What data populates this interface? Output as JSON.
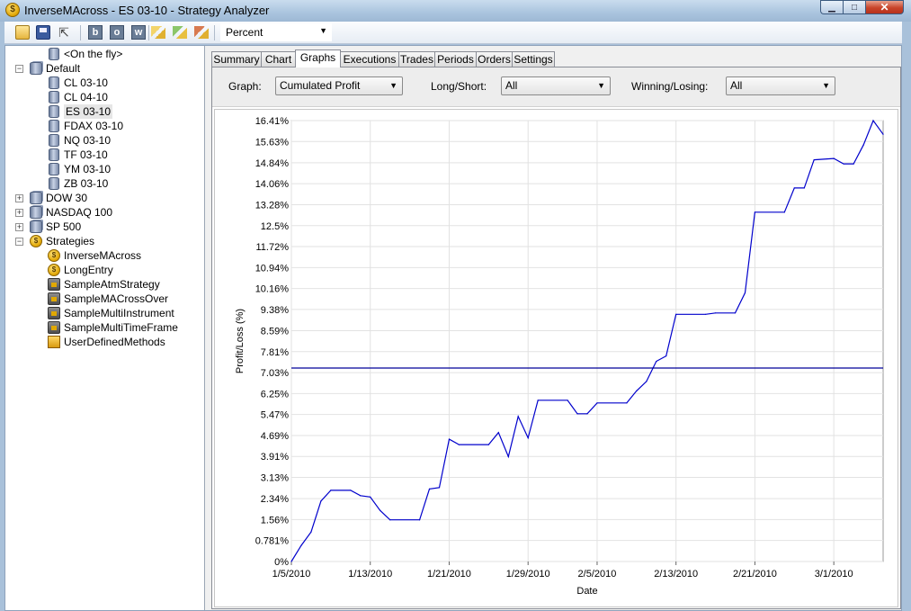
{
  "window": {
    "title": "InverseMAcross - ES 03-10 - Strategy Analyzer"
  },
  "toolbar": {
    "letter_buttons": [
      "b",
      "o",
      "w"
    ],
    "display_unit": "Percent"
  },
  "tree": [
    {
      "label": "<On the fly>",
      "icon": "database-icon",
      "level": 1,
      "expander": ""
    },
    {
      "label": "Default",
      "icon": "database-stack-icon",
      "level": 0,
      "expander": "−"
    },
    {
      "label": "CL 03-10",
      "icon": "database-icon",
      "level": 1,
      "expander": ""
    },
    {
      "label": "CL 04-10",
      "icon": "database-icon",
      "level": 1,
      "expander": ""
    },
    {
      "label": "ES 03-10",
      "icon": "database-icon",
      "level": 1,
      "expander": "",
      "selected": true
    },
    {
      "label": "FDAX 03-10",
      "icon": "database-icon",
      "level": 1,
      "expander": ""
    },
    {
      "label": "NQ 03-10",
      "icon": "database-icon",
      "level": 1,
      "expander": ""
    },
    {
      "label": "TF 03-10",
      "icon": "database-icon",
      "level": 1,
      "expander": ""
    },
    {
      "label": "YM 03-10",
      "icon": "database-icon",
      "level": 1,
      "expander": ""
    },
    {
      "label": "ZB 03-10",
      "icon": "database-icon",
      "level": 1,
      "expander": ""
    },
    {
      "label": "DOW 30",
      "icon": "database-stack-icon",
      "level": 0,
      "expander": "+"
    },
    {
      "label": "NASDAQ 100",
      "icon": "database-stack-icon",
      "level": 0,
      "expander": "+"
    },
    {
      "label": "SP 500",
      "icon": "database-stack-icon",
      "level": 0,
      "expander": "+"
    },
    {
      "label": "Strategies",
      "icon": "coin-icon",
      "level": 0,
      "expander": "−"
    },
    {
      "label": "InverseMAcross",
      "icon": "coin-icon",
      "level": 1,
      "expander": ""
    },
    {
      "label": "LongEntry",
      "icon": "coin-icon",
      "level": 1,
      "expander": ""
    },
    {
      "label": "SampleAtmStrategy",
      "icon": "lock-icon",
      "level": 1,
      "expander": ""
    },
    {
      "label": "SampleMACrossOver",
      "icon": "lock-icon",
      "level": 1,
      "expander": ""
    },
    {
      "label": "SampleMultiInstrument",
      "icon": "lock-icon",
      "level": 1,
      "expander": ""
    },
    {
      "label": "SampleMultiTimeFrame",
      "icon": "lock-icon",
      "level": 1,
      "expander": ""
    },
    {
      "label": "UserDefinedMethods",
      "icon": "box-icon",
      "level": 1,
      "expander": ""
    }
  ],
  "tabs": [
    "Summary",
    "Chart",
    "Graphs",
    "Executions",
    "Trades",
    "Periods",
    "Orders",
    "Settings"
  ],
  "active_tab": "Graphs",
  "filters": {
    "graph_label": "Graph:",
    "graph_value": "Cumulated Profit",
    "longshort_label": "Long/Short:",
    "longshort_value": "All",
    "winlose_label": "Winning/Losing:",
    "winlose_value": "All"
  },
  "chart_data": {
    "type": "line",
    "xlabel": "Date",
    "ylabel": "Profit/Loss (%)",
    "ytick_labels": [
      "0%",
      "0.781%",
      "1.56%",
      "2.34%",
      "3.13%",
      "3.91%",
      "4.69%",
      "5.47%",
      "6.25%",
      "7.03%",
      "7.81%",
      "8.59%",
      "9.38%",
      "10.16%",
      "10.94%",
      "11.72%",
      "12.5%",
      "13.28%",
      "14.06%",
      "14.84%",
      "15.63%",
      "16.41%"
    ],
    "ytick_values": [
      0,
      0.781,
      1.56,
      2.34,
      3.13,
      3.91,
      4.69,
      5.47,
      6.25,
      7.03,
      7.81,
      8.59,
      9.38,
      10.16,
      10.94,
      11.72,
      12.5,
      13.28,
      14.06,
      14.84,
      15.63,
      16.41
    ],
    "ylim": [
      0,
      16.41
    ],
    "xtick_labels": [
      "1/5/2010",
      "1/13/2010",
      "1/21/2010",
      "1/29/2010",
      "2/5/2010",
      "2/13/2010",
      "2/21/2010",
      "3/1/2010"
    ],
    "xtick_dates": [
      "2010-01-05",
      "2010-01-13",
      "2010-01-21",
      "2010-01-29",
      "2010-02-05",
      "2010-02-13",
      "2010-02-21",
      "2010-03-01"
    ],
    "xlim": [
      "2010-01-05",
      "2010-03-05"
    ],
    "grid": true,
    "series": [
      {
        "color": "#0000cc",
        "points": [
          [
            "2010-01-05",
            0.0
          ],
          [
            "2010-01-06",
            0.6
          ],
          [
            "2010-01-07",
            1.1
          ],
          [
            "2010-01-08",
            2.25
          ],
          [
            "2010-01-09",
            2.65
          ],
          [
            "2010-01-11",
            2.65
          ],
          [
            "2010-01-12",
            2.45
          ],
          [
            "2010-01-13",
            2.4
          ],
          [
            "2010-01-14",
            1.9
          ],
          [
            "2010-01-15",
            1.55
          ],
          [
            "2010-01-18",
            1.55
          ],
          [
            "2010-01-19",
            2.7
          ],
          [
            "2010-01-20",
            2.75
          ],
          [
            "2010-01-21",
            4.55
          ],
          [
            "2010-01-22",
            4.35
          ],
          [
            "2010-01-25",
            4.35
          ],
          [
            "2010-01-26",
            4.8
          ],
          [
            "2010-01-27",
            3.9
          ],
          [
            "2010-01-28",
            5.4
          ],
          [
            "2010-01-29",
            4.6
          ],
          [
            "2010-01-30",
            6.0
          ],
          [
            "2010-02-02",
            6.0
          ],
          [
            "2010-02-03",
            5.5
          ],
          [
            "2010-02-04",
            5.5
          ],
          [
            "2010-02-05",
            5.9
          ],
          [
            "2010-02-08",
            5.9
          ],
          [
            "2010-02-09",
            6.35
          ],
          [
            "2010-02-10",
            6.7
          ],
          [
            "2010-02-11",
            7.45
          ],
          [
            "2010-02-12",
            7.65
          ],
          [
            "2010-02-13",
            9.2
          ],
          [
            "2010-02-16",
            9.2
          ],
          [
            "2010-02-17",
            9.25
          ],
          [
            "2010-02-19",
            9.25
          ],
          [
            "2010-02-20",
            10.0
          ],
          [
            "2010-02-21",
            13.0
          ],
          [
            "2010-02-24",
            13.0
          ],
          [
            "2010-02-25",
            13.9
          ],
          [
            "2010-02-26",
            13.9
          ],
          [
            "2010-02-27",
            14.95
          ],
          [
            "2010-03-01",
            15.0
          ],
          [
            "2010-03-02",
            14.8
          ],
          [
            "2010-03-03",
            14.8
          ],
          [
            "2010-03-04",
            15.5
          ],
          [
            "2010-03-05",
            16.41
          ],
          [
            "2010-03-06",
            15.9
          ]
        ]
      },
      {
        "color": "#000099",
        "points": [
          [
            "2010-01-05",
            7.2
          ],
          [
            "2010-03-06",
            7.2
          ]
        ]
      }
    ]
  }
}
